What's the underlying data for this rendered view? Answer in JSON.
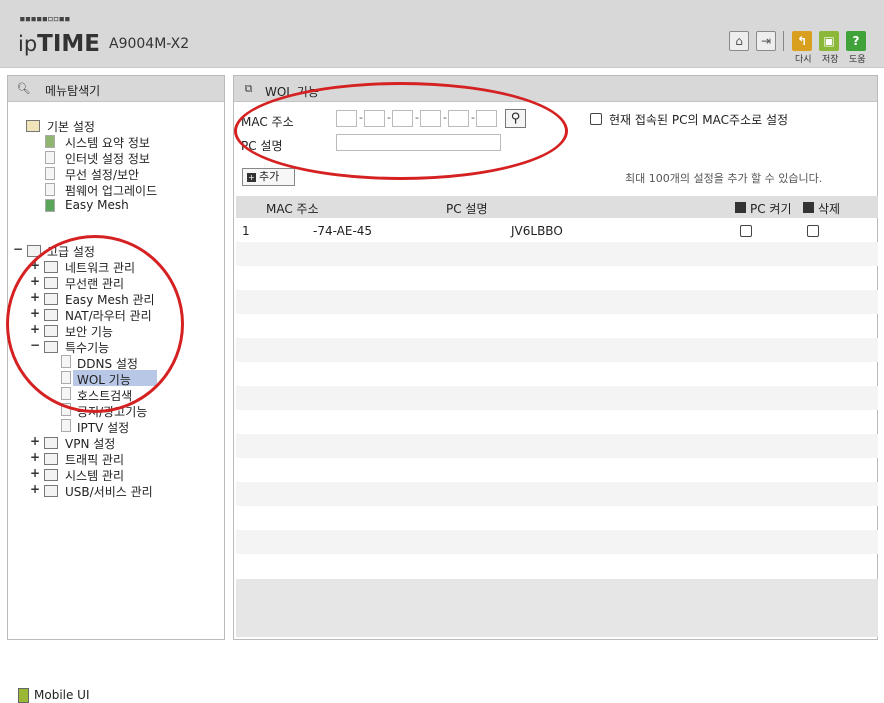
{
  "header": {
    "logo_dots": "▪▪▪▪▪▫▫▪▪",
    "logo_prefix": "ip",
    "logo_brand": "TIME",
    "model": "A9004M-X2",
    "buttons": {
      "reload_label": "다시",
      "save_label": "저장",
      "help_label": "도움"
    },
    "accent": {
      "reload": "#d9a020",
      "save": "#8cb83a",
      "help": "#3fa33a"
    }
  },
  "sidebar": {
    "title": "메뉴탐색기",
    "basic": {
      "label": "기본 설정",
      "items": [
        "시스템 요약 정보",
        "인터넷 설정 정보",
        "무선 설정/보안",
        "펌웨어 업그레이드",
        "Easy Mesh"
      ]
    },
    "advanced": {
      "label": "고급 설정",
      "items": [
        "네트워크 관리",
        "무선랜 관리",
        "Easy Mesh 관리",
        "NAT/라우터 관리",
        "보안 기능",
        "특수기능"
      ],
      "special_items": [
        "DDNS 설정",
        "WOL 기능",
        "호스트검색",
        "공지/광고기능",
        "IPTV 설정"
      ],
      "more_items": [
        "VPN 설정",
        "트래픽 관리",
        "시스템 관리",
        "USB/서비스 관리"
      ]
    },
    "footer": "Mobile UI"
  },
  "main": {
    "title": "WOL 기능",
    "mac_label": "MAC 주소",
    "pc_label": "PC 설명",
    "current_pc_label": "현재 접속된 PC의 MAC주소로 설정",
    "add_label": "추가",
    "limit_text": "최대 100개의 설정을 추가 할 수 있습니다.",
    "columns": {
      "mac": "MAC 주소",
      "pc": "PC 설명",
      "wake": "PC 켜기",
      "delete": "삭제"
    },
    "rows": [
      {
        "num": "1",
        "mac": "-74-AE-45",
        "pc": "JV6LBBO"
      }
    ]
  }
}
